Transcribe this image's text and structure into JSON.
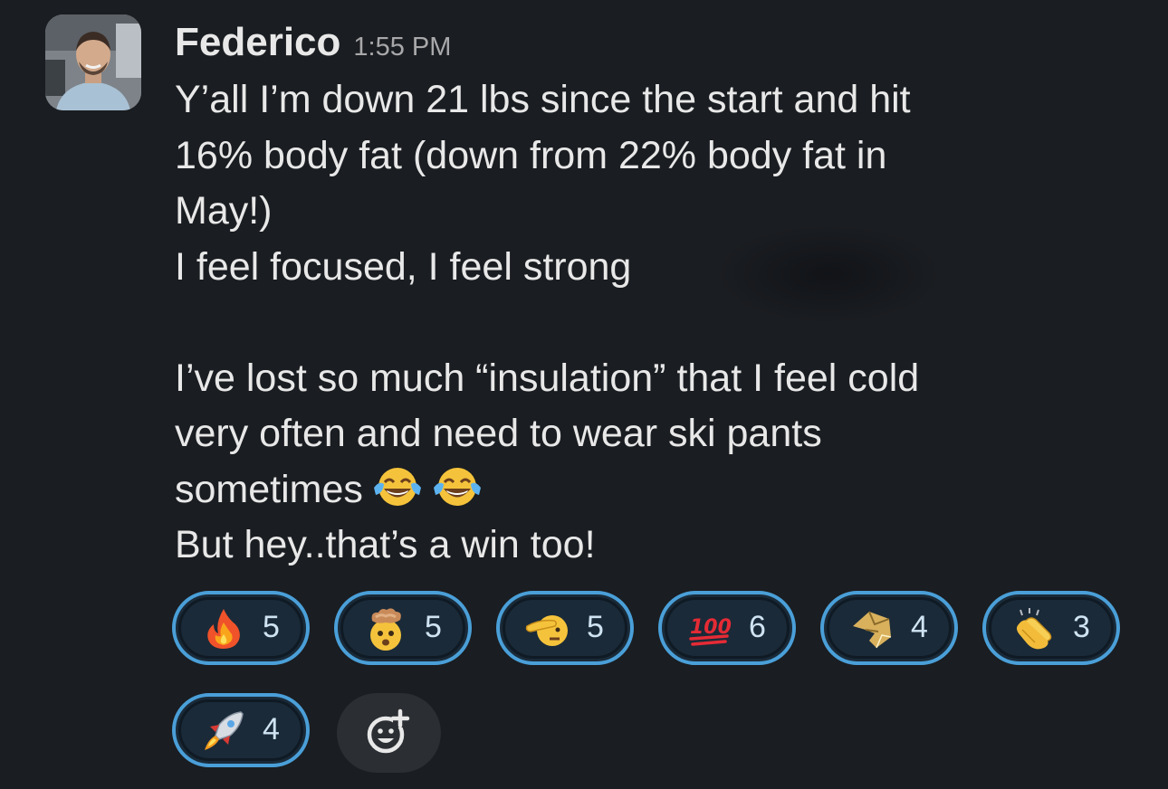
{
  "message": {
    "author": "Federico",
    "timestamp": "1:55 PM",
    "lines": [
      "Y’all I’m down 21 lbs since the start and hit",
      "16% body fat (down from 22% body fat in",
      "May!)",
      "I feel focused, I feel strong",
      "",
      "I’ve lost so much “insulation” that I feel cold",
      "very often and need to wear ski pants",
      "sometimes",
      "But hey..that’s a win too!"
    ],
    "inline_emojis": [
      "face-with-tears-of-joy-icon",
      "face-with-tears-of-joy-icon"
    ]
  },
  "reactions": [
    {
      "icon": "fire-icon",
      "count": "5"
    },
    {
      "icon": "exploding-head-icon",
      "count": "5"
    },
    {
      "icon": "saluting-face-icon",
      "count": "5"
    },
    {
      "icon": "hundred-points-icon",
      "count": "6"
    },
    {
      "icon": "gold-lion-logo-icon",
      "count": "4"
    },
    {
      "icon": "clapping-hands-icon",
      "count": "3"
    },
    {
      "icon": "rocket-icon",
      "count": "4"
    }
  ],
  "add_reaction": {
    "icon": "add-emoji-icon"
  },
  "colors": {
    "background": "#1a1d21",
    "text": "#e8e8e8",
    "timestamp": "#a8a8aa",
    "reaction_border": "#4a9fd8",
    "reaction_bg": "#1a2a38",
    "add_reaction_bg": "#2b2e33"
  }
}
